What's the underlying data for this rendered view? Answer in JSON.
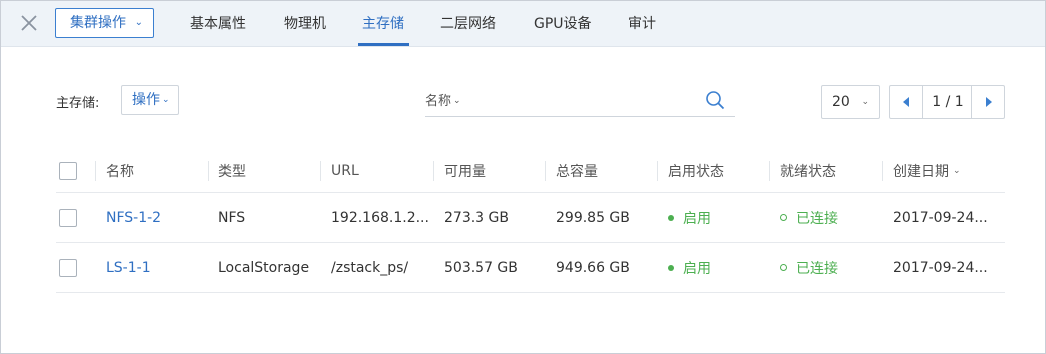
{
  "nav": {
    "cluster_action_label": "集群操作",
    "tabs": [
      {
        "label": "基本属性"
      },
      {
        "label": "物理机"
      },
      {
        "label": "主存储"
      },
      {
        "label": "二层网络"
      },
      {
        "label": "GPU设备"
      },
      {
        "label": "审计"
      }
    ],
    "active_tab": "主存储"
  },
  "toolbar": {
    "primary_storage_label": "主存储:",
    "action_label": "操作",
    "search_field_label": "名称",
    "search_placeholder": "",
    "page_size": "20",
    "page_info": "1 / 1"
  },
  "table": {
    "columns": [
      "名称",
      "类型",
      "URL",
      "可用量",
      "总容量",
      "启用状态",
      "就绪状态",
      "创建日期"
    ],
    "rows": [
      {
        "name": "NFS-1-2",
        "type": "NFS",
        "url": "192.168.1.2...",
        "available": "273.3 GB",
        "total": "299.85 GB",
        "enable_state": "启用",
        "ready_state": "已连接",
        "created": "2017-09-24..."
      },
      {
        "name": "LS-1-1",
        "type": "LocalStorage",
        "url": "/zstack_ps/",
        "available": "503.57 GB",
        "total": "949.66 GB",
        "enable_state": "启用",
        "ready_state": "已连接",
        "created": "2017-09-24..."
      }
    ]
  },
  "colors": {
    "accent": "#2f6fc2",
    "status_green": "#4caf50",
    "topbar_bg": "#eef3f8"
  },
  "icons": [
    "close-icon",
    "chevron-down-icon",
    "search-icon",
    "prev-page-icon",
    "next-page-icon"
  ]
}
